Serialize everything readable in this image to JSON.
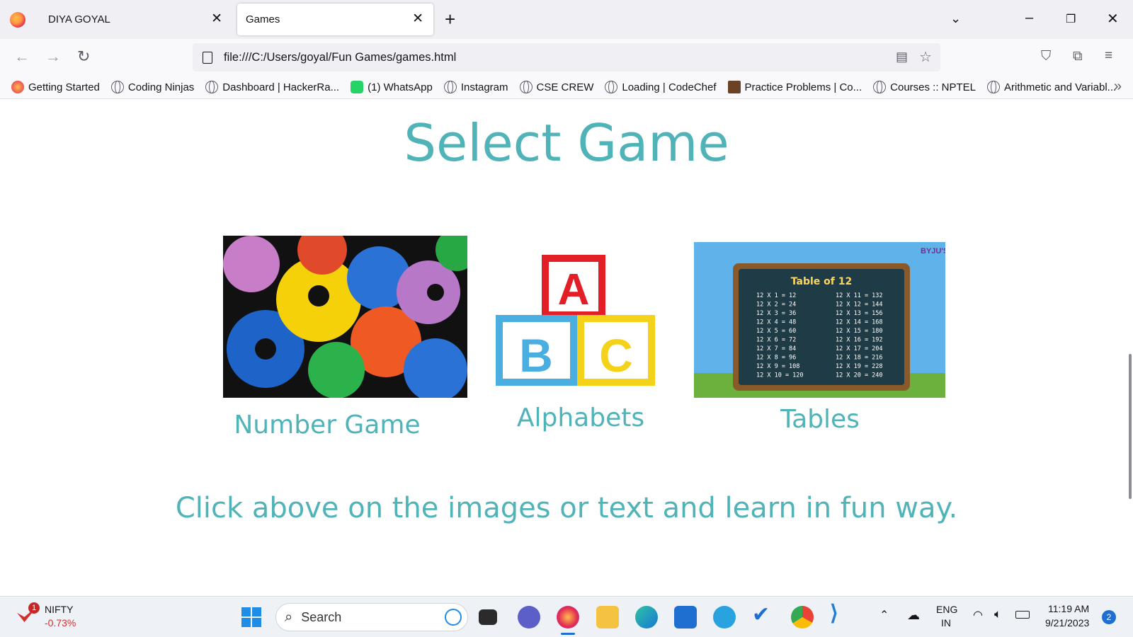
{
  "browser": {
    "tabs": [
      {
        "label": "DIYA GOYAL",
        "active": false
      },
      {
        "label": "Games",
        "active": true
      }
    ],
    "url": "file:///C:/Users/goyal/Fun Games/games.html",
    "bookmarks": [
      "Getting Started",
      "Coding Ninjas",
      "Dashboard | HackerRa...",
      "(1) WhatsApp",
      "Instagram",
      "CSE CREW",
      "Loading | CodeChef",
      "Practice Problems | Co...",
      "Courses :: NPTEL",
      "Arithmetic and Variabl..."
    ]
  },
  "page": {
    "title": "Select Game",
    "cards": [
      {
        "label": "Number Game"
      },
      {
        "label": "Alphabets"
      },
      {
        "label": "Tables"
      }
    ],
    "hint": "Click above on the images or text and learn in fun way.",
    "images": {
      "alphabet_letters": [
        "A",
        "B",
        "C"
      ],
      "tables_header": "Table of 12",
      "tables_left": [
        "12 X 1 = 12",
        "12 X 2 = 24",
        "12 X 3 = 36",
        "12 X 4 = 48",
        "12 X 5 = 60",
        "12 X 6 = 72",
        "12 X 7 = 84",
        "12 X 8 = 96",
        "12 X 9 = 108",
        "12 X 10 = 120"
      ],
      "tables_right": [
        "12 X 11 = 132",
        "12 X 12 = 144",
        "12 X 13 = 156",
        "12 X 14 = 168",
        "12 X 15 = 180",
        "12 X 16 = 192",
        "12 X 17 = 204",
        "12 X 18 = 216",
        "12 X 19 = 228",
        "12 X 20 = 240"
      ],
      "tables_brand": "BYJU'S"
    }
  },
  "taskbar": {
    "widget_name": "NIFTY",
    "widget_change": "-0.73%",
    "widget_badge": "1",
    "search_placeholder": "Search",
    "lang_line1": "ENG",
    "lang_line2": "IN",
    "time": "11:19 AM",
    "date": "9/21/2023",
    "notification_count": "2",
    "colors": {
      "accent": "#4fb3b8",
      "negative": "#d32f2f"
    }
  }
}
